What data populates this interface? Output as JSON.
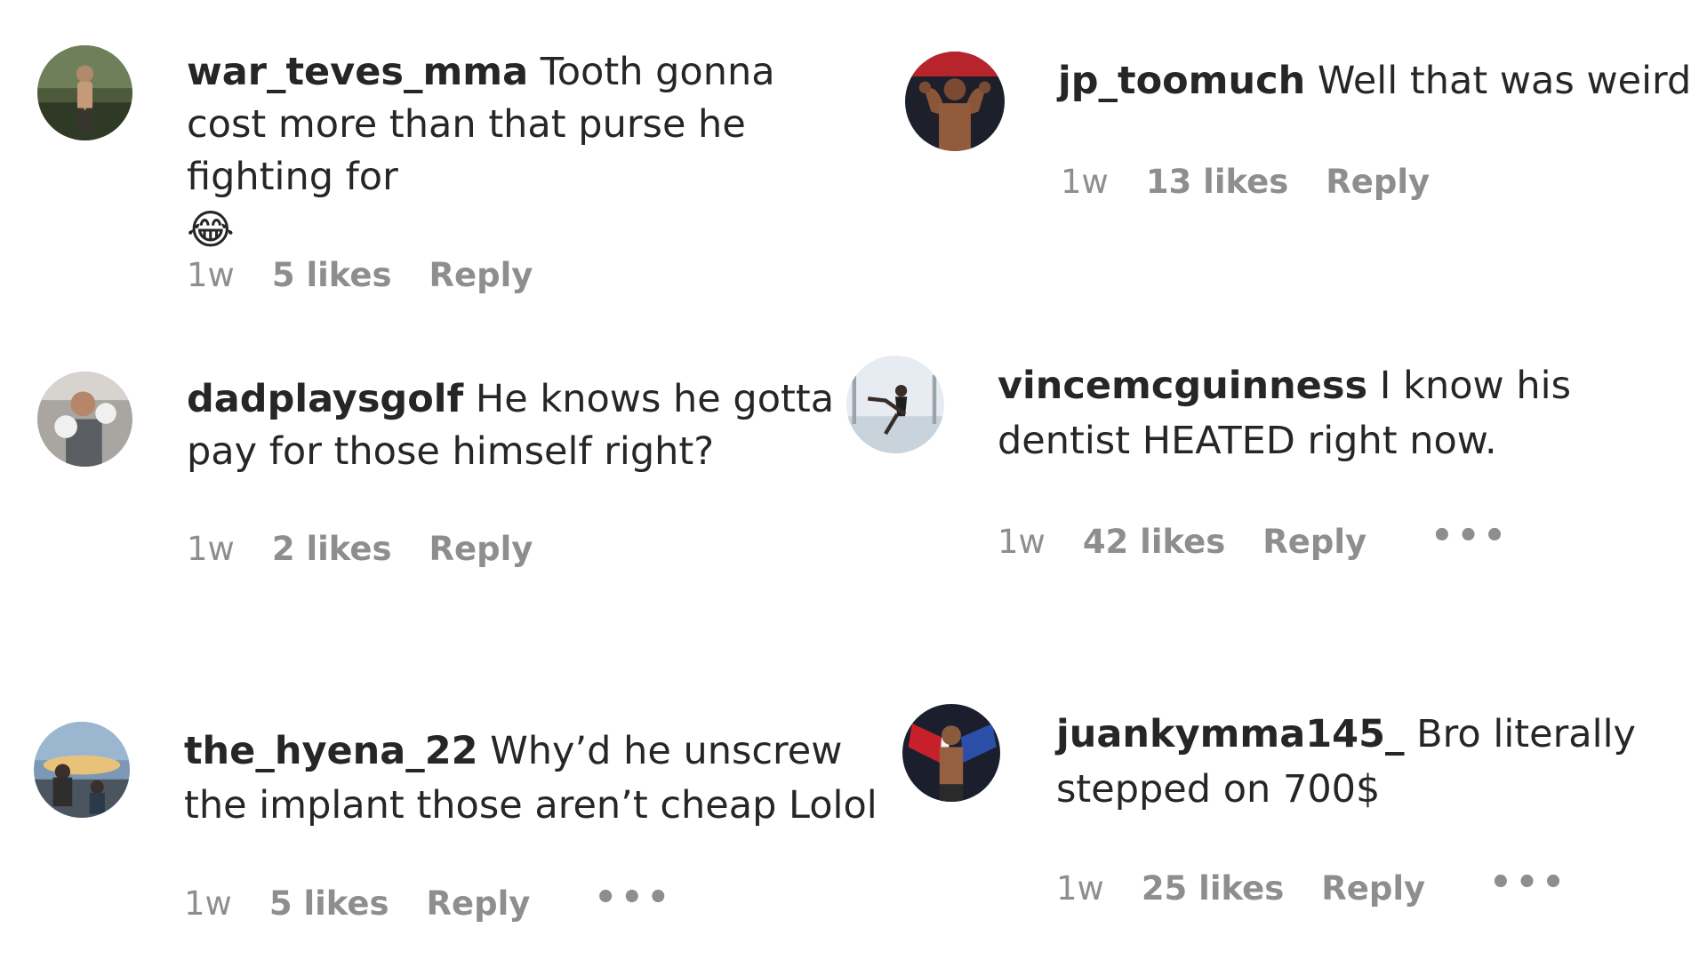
{
  "comments": [
    {
      "username": "war_teves_mma",
      "text": "Tooth gonna cost more than that purse he fighting for",
      "emoji": "😂",
      "time": "1w",
      "likes": "5 likes",
      "reply": "Reply"
    },
    {
      "username": "jp_toomuch",
      "text": "Well that was weird",
      "time": "1w",
      "likes": "13 likes",
      "reply": "Reply"
    },
    {
      "username": "dadplaysgolf",
      "text": "He knows he gotta pay for those himself right?",
      "time": "1w",
      "likes": "2 likes",
      "reply": "Reply"
    },
    {
      "username": "vincemcguinness",
      "text": "I know his dentist HEATED right now.",
      "time": "1w",
      "likes": "42 likes",
      "reply": "Reply",
      "more": "•••"
    },
    {
      "username": "the_hyena_22",
      "text": "Why’d he unscrew the implant those aren’t cheap Lolol",
      "time": "1w",
      "likes": "5 likes",
      "reply": "Reply",
      "more": "•••"
    },
    {
      "username": "juankymma145_",
      "text": "Bro literally stepped on 700$",
      "time": "1w",
      "likes": "25 likes",
      "reply": "Reply",
      "more": "•••"
    }
  ]
}
